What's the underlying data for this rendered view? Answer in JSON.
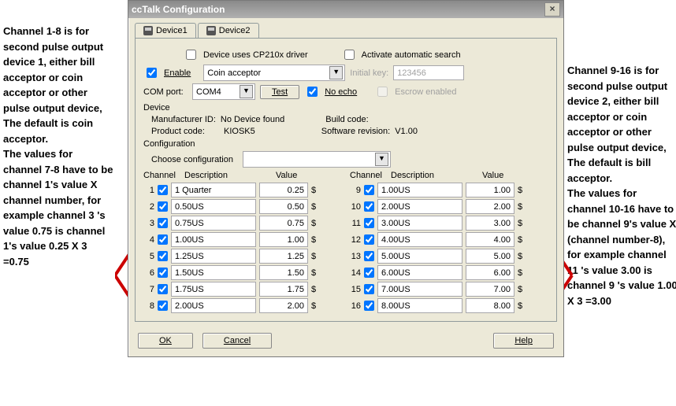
{
  "window": {
    "title": "ccTalk Configuration"
  },
  "tabs": [
    "Device1",
    "Device2"
  ],
  "options": {
    "use_cp210x": "Device uses CP210x driver",
    "activate_auto": "Activate automatic search",
    "enable": "Enable",
    "device_type": "Coin acceptor",
    "initial_key_label": "Initial key:",
    "initial_key": "123456",
    "com_port_label": "COM port:",
    "com_port": "COM4",
    "test": "Test",
    "no_echo": "No echo",
    "escrow": "Escrow enabled"
  },
  "device": {
    "section": "Device",
    "mfr_label": "Manufacturer ID:",
    "mfr": "No Device found",
    "build_label": "Build code:",
    "prod_label": "Product code:",
    "prod": "KIOSK5",
    "swrev_label": "Software revision:",
    "swrev": "V1.00"
  },
  "config": {
    "section": "Configuration",
    "choose": "Choose configuration",
    "hdr_channel": "Channel",
    "hdr_desc": "Description",
    "hdr_value": "Value",
    "currency": "$"
  },
  "left": [
    {
      "n": "1",
      "d": "1 Quarter",
      "v": "0.25"
    },
    {
      "n": "2",
      "d": "0.50US",
      "v": "0.50"
    },
    {
      "n": "3",
      "d": "0.75US",
      "v": "0.75"
    },
    {
      "n": "4",
      "d": "1.00US",
      "v": "1.00"
    },
    {
      "n": "5",
      "d": "1.25US",
      "v": "1.25"
    },
    {
      "n": "6",
      "d": "1.50US",
      "v": "1.50"
    },
    {
      "n": "7",
      "d": "1.75US",
      "v": "1.75"
    },
    {
      "n": "8",
      "d": "2.00US",
      "v": "2.00"
    }
  ],
  "right": [
    {
      "n": "9",
      "d": "1.00US",
      "v": "1.00"
    },
    {
      "n": "10",
      "d": "2.00US",
      "v": "2.00"
    },
    {
      "n": "11",
      "d": "3.00US",
      "v": "3.00"
    },
    {
      "n": "12",
      "d": "4.00US",
      "v": "4.00"
    },
    {
      "n": "13",
      "d": "5.00US",
      "v": "5.00"
    },
    {
      "n": "14",
      "d": "6.00US",
      "v": "6.00"
    },
    {
      "n": "15",
      "d": "7.00US",
      "v": "7.00"
    },
    {
      "n": "16",
      "d": "8.00US",
      "v": "8.00"
    }
  ],
  "buttons": {
    "ok": "OK",
    "cancel": "Cancel",
    "help": "Help"
  },
  "annot_left": "Channel 1-8 is for second pulse output device 1, either bill acceptor or coin acceptor or other pulse output device, The default is coin acceptor.\nThe values for channel 7-8 have to be channel 1's value X channel number, for example channel 3 's value 0.75 is channel 1's value 0.25 X 3 =0.75",
  "annot_right": "Channel 9-16 is for second pulse output device 2, either bill acceptor or coin acceptor or other pulse output device, The default is bill acceptor.\nThe values for channel 10-16 have to be channel 9's value X (channel number-8), for example channel 11 's value 3.00 is channel 9 's value 1.00 X 3 =3.00"
}
